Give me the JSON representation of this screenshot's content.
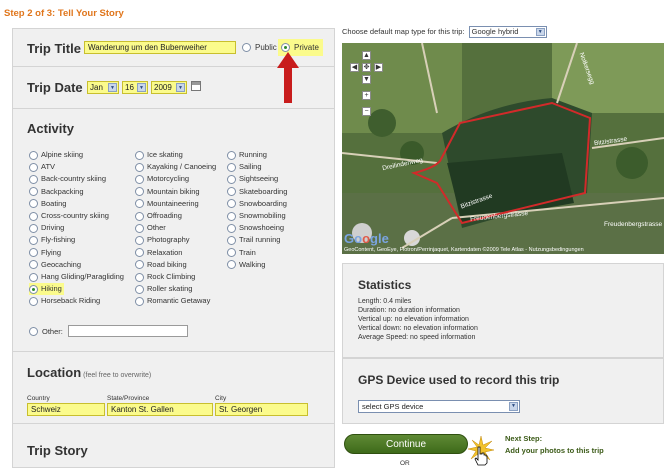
{
  "step": "Step 2 of 3: Tell Your Story",
  "trip_title": {
    "label": "Trip Title",
    "value": "Wanderung um den Bubenweiher",
    "public": "Public",
    "private": "Private"
  },
  "trip_date": {
    "label": "Trip Date",
    "month": "Jan",
    "day": "16",
    "year": "2009"
  },
  "activity": {
    "label": "Activity",
    "col1": [
      "Alpine skiing",
      "ATV",
      "Back-country skiing",
      "Backpacking",
      "Boating",
      "Cross-country skiing",
      "Driving",
      "Fly-fishing",
      "Flying",
      "Geocaching",
      "Hang Gliding/Paragliding",
      "Hiking",
      "Horseback Riding"
    ],
    "col2": [
      "Ice skating",
      "Kayaking / Canoeing",
      "Motorcycling",
      "Mountain biking",
      "Mountaineering",
      "Offroading",
      "Other",
      "Photography",
      "Relaxation",
      "Road biking",
      "Rock Climbing",
      "Roller skating",
      "Romantic Getaway"
    ],
    "col3": [
      "Running",
      "Sailing",
      "Sightseeing",
      "Skateboarding",
      "Snowboarding",
      "Snowmobiling",
      "Snowshoeing",
      "Trail running",
      "Train",
      "Walking"
    ],
    "selected": "Hiking",
    "other": "Other:"
  },
  "location": {
    "label": "Location",
    "hint": "(feel free to overwrite)",
    "country_label": "Country",
    "country": "Schweiz",
    "state_label": "State/Province",
    "state": "Kanton St. Gallen",
    "city_label": "City",
    "city": "St. Georgen"
  },
  "story": {
    "label": "Trip Story"
  },
  "map": {
    "type_label": "Choose default map type for this trip:",
    "type_value": "Google hybrid",
    "roads": [
      "Dreilindenweg",
      "Freudenbergstrasse",
      "Bitzistrasse",
      "Bitzistrasse",
      "Freudenbergstrasse",
      "Notkersegg"
    ],
    "copyright": "GeoContent, GeoEye, Flotron/Perrinjaquet, Kartendaten ©2009 Tele Atlas - Nutzungsbedingungen"
  },
  "statistics": {
    "title": "Statistics",
    "lines": [
      "Length: 0.4 miles",
      "Duration: no duration information",
      "Vertical up: no elevation information",
      "Vertical down: no elevation information",
      "Average Speed: no speed information"
    ]
  },
  "gps": {
    "title": "GPS Device used to record this trip",
    "placeholder": "select GPS device"
  },
  "actions": {
    "continue": "Continue",
    "next_step": "Next Step:",
    "next_desc": "Add your photos to this trip",
    "or": "OR"
  },
  "colors": {
    "highlight": "#fbfb8c",
    "step": "#e0761c",
    "button": "#4a7524",
    "route": "#d22a2a",
    "arrow": "#c81c1c"
  }
}
